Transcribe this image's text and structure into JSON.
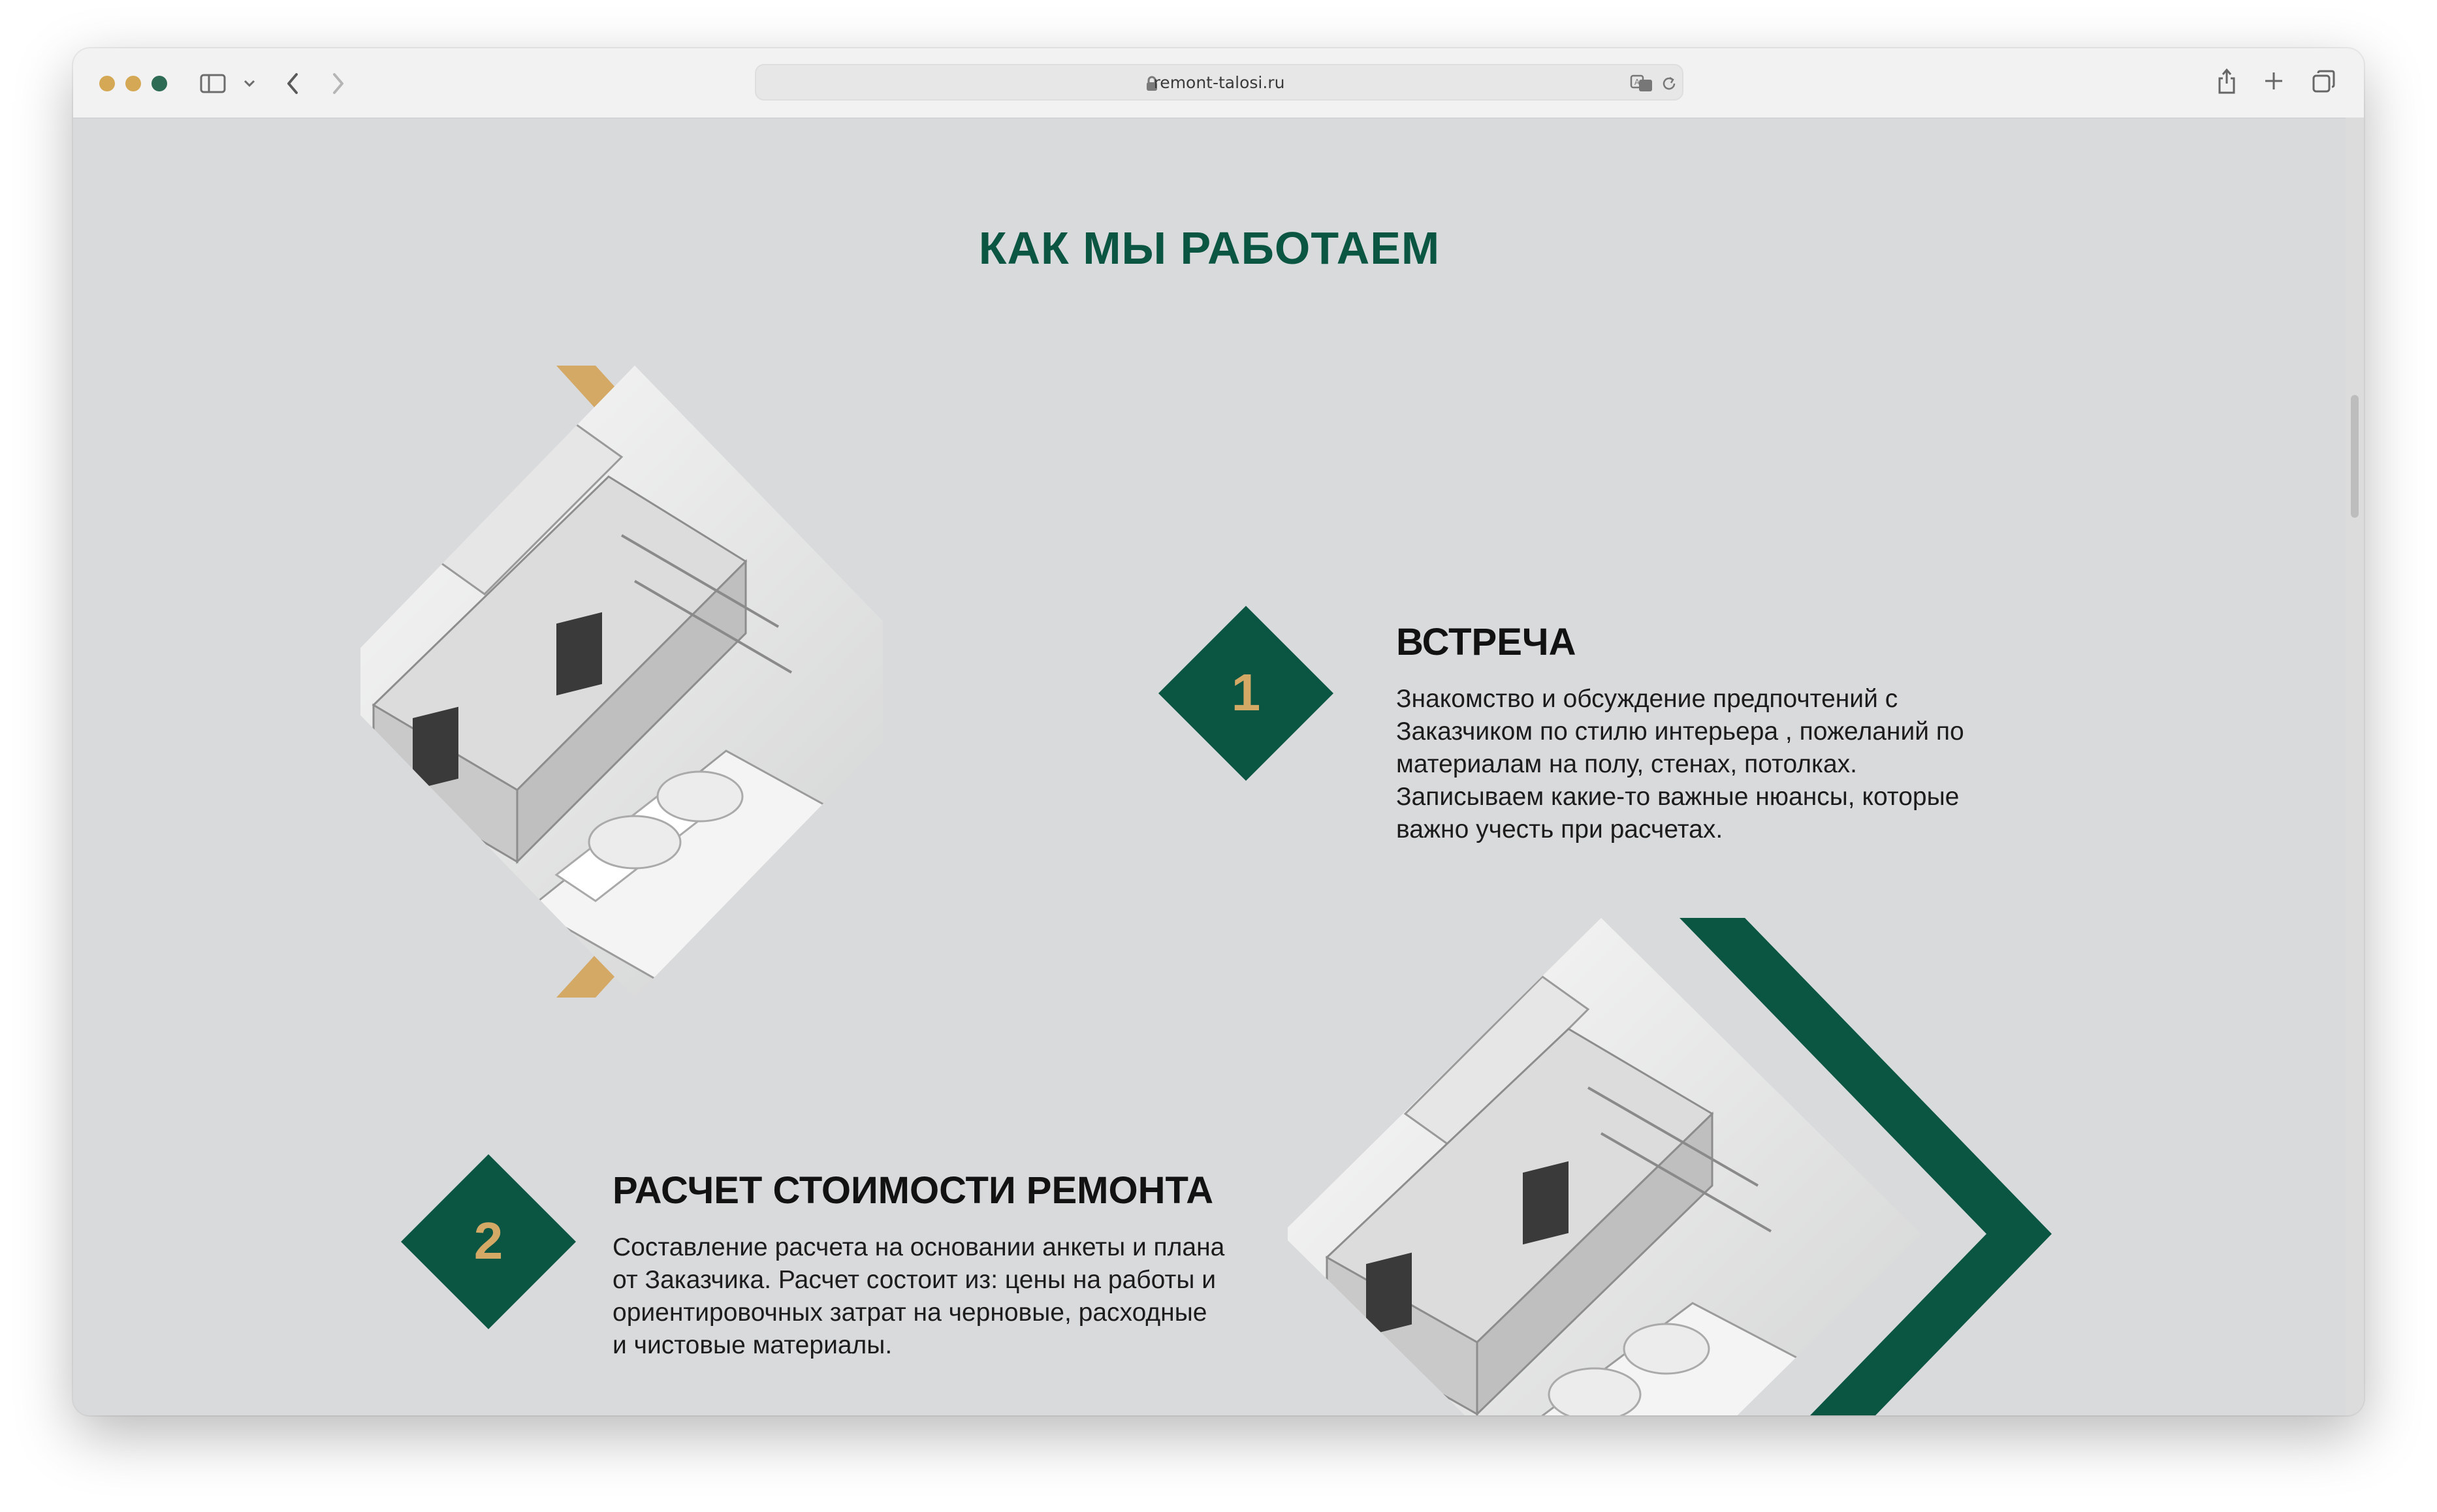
{
  "browser": {
    "url": "remont-talosi.ru",
    "traffic_lights": [
      "#d4a855",
      "#d4a855",
      "#2e6b55"
    ]
  },
  "page": {
    "section_title": "КАК МЫ РАБОТАЕМ",
    "steps": [
      {
        "number": "1",
        "heading": "ВСТРЕЧА",
        "lines": [
          "Знакомство и обсуждение предпочтений с",
          "Заказчиком по стилю интерьера , пожеланий по",
          "материалам на полу, стенах, потолках.",
          "Записываем какие-то важные нюансы, которые",
          "важно учесть при расчетах."
        ]
      },
      {
        "number": "2",
        "heading": "РАСЧЕТ СТОИМОСТИ РЕМОНТА",
        "lines": [
          "Составление расчета на основании анкеты и плана",
          "от Заказчика. Расчет состоит из: цены на работы и",
          "ориентировочных затрат на черновые, расходные",
          "и чистовые материалы."
        ]
      }
    ],
    "colors": {
      "accent_green": "#0b5642",
      "accent_gold": "#d4a865",
      "background": "#d9dadc"
    }
  }
}
